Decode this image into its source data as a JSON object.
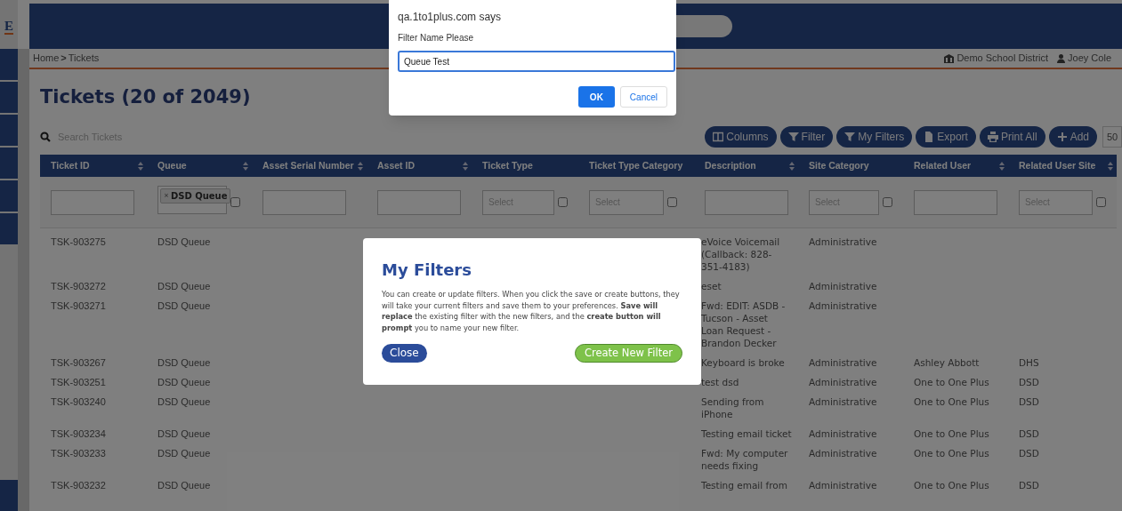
{
  "logo": "E",
  "alert": {
    "origin": "qa.1to1plus.com says",
    "prompt": "Filter Name Please",
    "value": "Queue Test",
    "buttons": [
      {
        "label": "OK",
        "kind": "primary"
      },
      {
        "label": "Cancel",
        "kind": "secondary"
      }
    ]
  },
  "breadcrumb": {
    "items": [
      "Home",
      "Tickets"
    ],
    "separator": ">"
  },
  "account": {
    "district": "Demo School District",
    "user": "Joey Cole"
  },
  "title": "Tickets (20 of 2049)",
  "search": {
    "placeholder": "Search Tickets"
  },
  "toolbar": [
    {
      "label": "Columns"
    },
    {
      "label": "Filter"
    },
    {
      "label": "My Filters"
    },
    {
      "label": "Export"
    },
    {
      "label": "Print All"
    },
    {
      "label": "Add"
    }
  ],
  "page_size": "50",
  "table": {
    "columns": [
      {
        "label": "Ticket ID",
        "sortable": true
      },
      {
        "label": "Queue",
        "sortable": true
      },
      {
        "label": "Asset Serial Number",
        "sortable": true
      },
      {
        "label": "Asset ID",
        "sortable": true
      },
      {
        "label": "Ticket Type",
        "sortable": false
      },
      {
        "label": "Ticket Type Category",
        "sortable": false
      },
      {
        "label": "Description",
        "sortable": true
      },
      {
        "label": "Site Category",
        "sortable": false
      },
      {
        "label": "Related User",
        "sortable": true
      },
      {
        "label": "Related User Site",
        "sortable": true
      }
    ],
    "filters": [
      {
        "kind": "text"
      },
      {
        "kind": "tags",
        "tags": [
          {
            "remove": "×",
            "label": "DSD Queue"
          }
        ],
        "checked": false
      },
      {
        "kind": "text"
      },
      {
        "kind": "text"
      },
      {
        "kind": "select",
        "placeholder": "Select",
        "checked": false
      },
      {
        "kind": "select",
        "placeholder": "Select",
        "checked": false
      },
      {
        "kind": "text"
      },
      {
        "kind": "select",
        "placeholder": "Select",
        "checked": false
      },
      {
        "kind": "text"
      },
      {
        "kind": "select",
        "placeholder": "Select",
        "checked": false
      }
    ],
    "rows": [
      [
        "TSK-903275",
        "DSD Queue",
        "",
        "",
        "",
        "",
        "eVoice Voicemail (Callback: 828-351-4183)",
        "Administrative",
        "",
        ""
      ],
      [
        "TSK-903272",
        "DSD Queue",
        "",
        "",
        "",
        "",
        "eset",
        "Administrative",
        "",
        ""
      ],
      [
        "TSK-903271",
        "DSD Queue",
        "",
        "",
        "",
        "",
        "Fwd: EDIT: ASDB - Tucson - Asset Loan Request - Brandon Decker",
        "Administrative",
        "",
        ""
      ],
      [
        "TSK-903267",
        "DSD Queue",
        "",
        "",
        "",
        "",
        "Keyboard is broke",
        "Administrative",
        "Ashley Abbott",
        "DHS"
      ],
      [
        "TSK-903251",
        "DSD Queue",
        "",
        "",
        "",
        "",
        "test dsd",
        "Administrative",
        "One to One Plus",
        "DSD"
      ],
      [
        "TSK-903240",
        "DSD Queue",
        "",
        "",
        "",
        "",
        "Sending from iPhone",
        "Administrative",
        "One to One Plus",
        "DSD"
      ],
      [
        "TSK-903234",
        "DSD Queue",
        "",
        "",
        "",
        "",
        "Testing email ticket",
        "Administrative",
        "One to One Plus",
        "DSD"
      ],
      [
        "TSK-903233",
        "DSD Queue",
        "",
        "",
        "",
        "",
        "Fwd: My computer needs fixing",
        "Administrative",
        "One to One Plus",
        "DSD"
      ],
      [
        "TSK-903232",
        "DSD Queue",
        "",
        "",
        "",
        "",
        "Testing email from",
        "Administrative",
        "One to One Plus",
        "DSD"
      ]
    ]
  },
  "modal": {
    "title": "My Filters",
    "text": "You can create or update filters. When you click the save or create buttons, they will take your current filters and save them to your preferences. **Save will replace** the existing filter with the new filters, and the **create button will prompt** you to name your new filter.",
    "buttons": [
      {
        "label": "Close",
        "kind": "close"
      },
      {
        "label": "Create New Filter",
        "kind": "create"
      }
    ]
  }
}
